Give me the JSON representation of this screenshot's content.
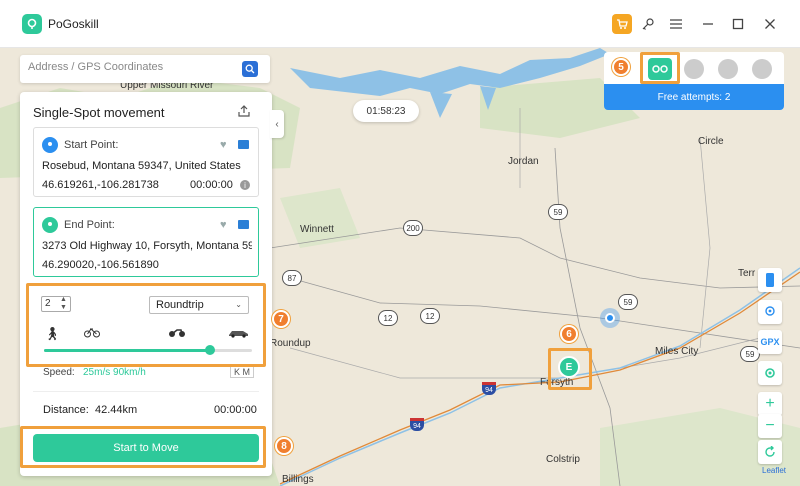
{
  "app": {
    "title": "PoGoskill"
  },
  "search": {
    "placeholder": "Address / GPS Coordinates"
  },
  "timer": "01:58:23",
  "panel": {
    "title": "Single-Spot movement",
    "start": {
      "label": "Start Point:",
      "address": "Rosebud, Montana 59347, United States",
      "coords": "46.619261,-106.281738",
      "time": "00:00:00"
    },
    "end": {
      "label": "End Point:",
      "address": "3273 Old Highway 10, Forsyth, Montana 59...",
      "coords": "46.290020,-106.561890"
    },
    "count": "2",
    "route_mode": "Roundtrip",
    "speed_label": "Speed:",
    "speed_value": "25m/s 90km/h",
    "speed_unit": "K  M",
    "slider_fraction": 0.8,
    "distance_label": "Distance:",
    "distance_value": "42.44km",
    "distance_time": "00:00:00",
    "move_button": "Start to Move"
  },
  "modebar": {
    "attempts": "Free attempts: 2"
  },
  "steps": {
    "s5": "5",
    "s6": "6",
    "s7": "7",
    "s8": "8"
  },
  "map": {
    "places": {
      "upper_missouri": "Upper Missouri River",
      "jordan": "Jordan",
      "circle": "Circle",
      "winnett": "Winnett",
      "roundup": "Roundup",
      "forsyth": "Forsyth",
      "miles_city": "Miles City",
      "colstrip": "Colstrip",
      "terry": "Terr",
      "billings": "Billings"
    },
    "shields": {
      "r200": "200",
      "r59a": "59",
      "r59b": "59",
      "r12a": "12",
      "r12b": "12",
      "r87": "87",
      "r59c": "59"
    },
    "interstates": {
      "i94a": "94",
      "i94b": "94"
    },
    "marker_letter": "E"
  },
  "right_tools": {
    "gpx": "GPX",
    "leaflet": "Leaflet"
  },
  "colors": {
    "accent": "#2ec99a",
    "highlight": "#f0a03c",
    "step_badge": "#f07f2f",
    "attempts_bg": "#2b8ff0",
    "water": "#8ec1e6"
  }
}
